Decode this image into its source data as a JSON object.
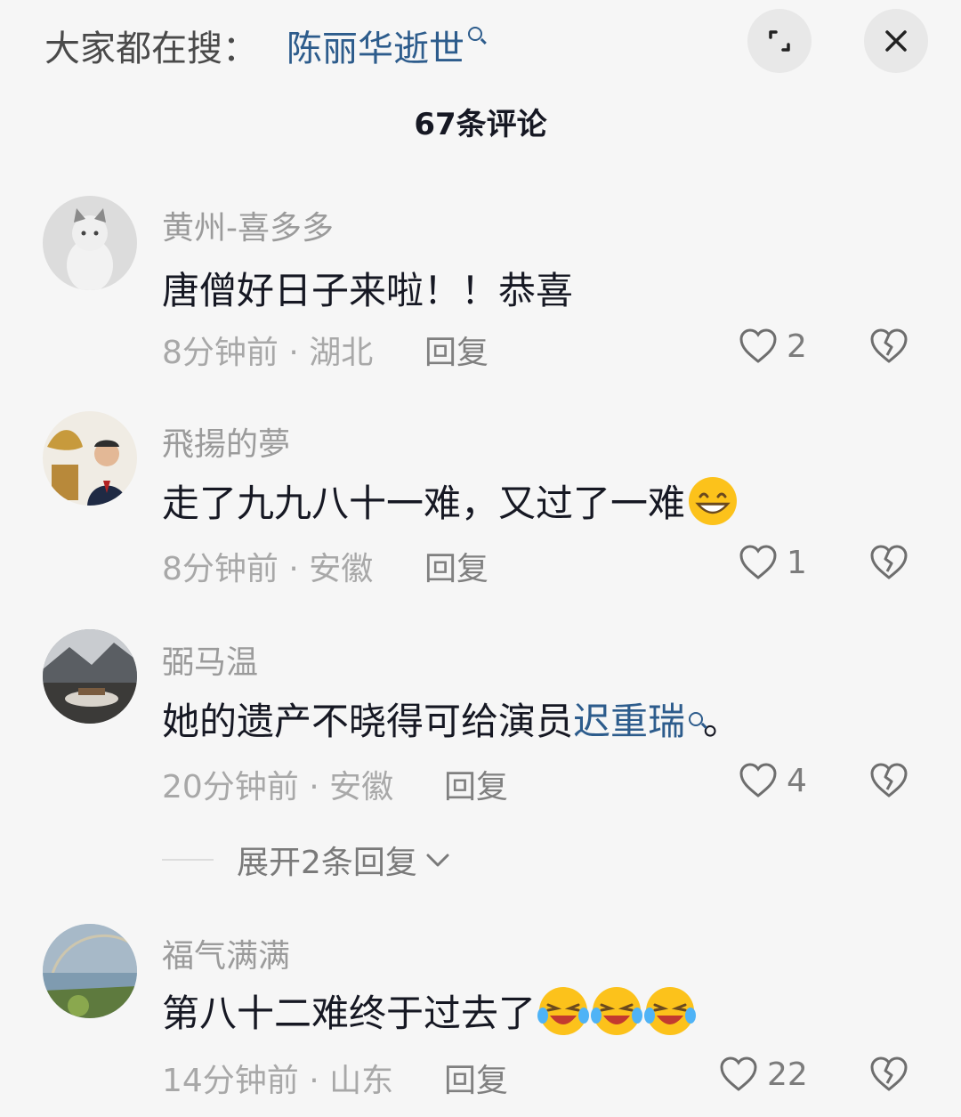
{
  "top_bar": {
    "search_label": "大家都在搜：",
    "search_term": "陈丽华逝世"
  },
  "header": {
    "comment_count": "67条评论"
  },
  "comments": [
    {
      "username": "黄州-喜多多",
      "text": "唐僧好日子来啦！！恭喜",
      "time": "8分钟前",
      "location": "湖北",
      "reply": "回复",
      "likes": "2"
    },
    {
      "username": "飛揚的夢",
      "text": "走了九九八十一难，又过了一难",
      "emoji": [
        "grin-emoji"
      ],
      "time": "8分钟前",
      "location": "安徽",
      "reply": "回复",
      "likes": "1"
    },
    {
      "username": "弼马温",
      "text": "她的遗产不晓得可给演员",
      "link": "迟重瑞",
      "suffix": "。",
      "time": "20分钟前",
      "location": "安徽",
      "reply": "回复",
      "likes": "4",
      "expand_replies": "展开2条回复"
    },
    {
      "username": "福气满满",
      "text": "第八十二难终于过去了",
      "emoji": [
        "laugh-cry-emoji",
        "laugh-cry-emoji",
        "laugh-cry-emoji"
      ],
      "time": "14分钟前",
      "location": "山东",
      "reply": "回复",
      "likes": "22"
    }
  ],
  "meta_separator": " · ",
  "icons": {
    "expand": "expand-icon",
    "close": "close-icon",
    "like": "heart-outline-icon",
    "dislike": "broken-heart-icon",
    "search": "search-icon",
    "chevron": "chevron-down-icon"
  },
  "colors": {
    "link": "#2d5c8c",
    "background": "#f6f6f6"
  }
}
